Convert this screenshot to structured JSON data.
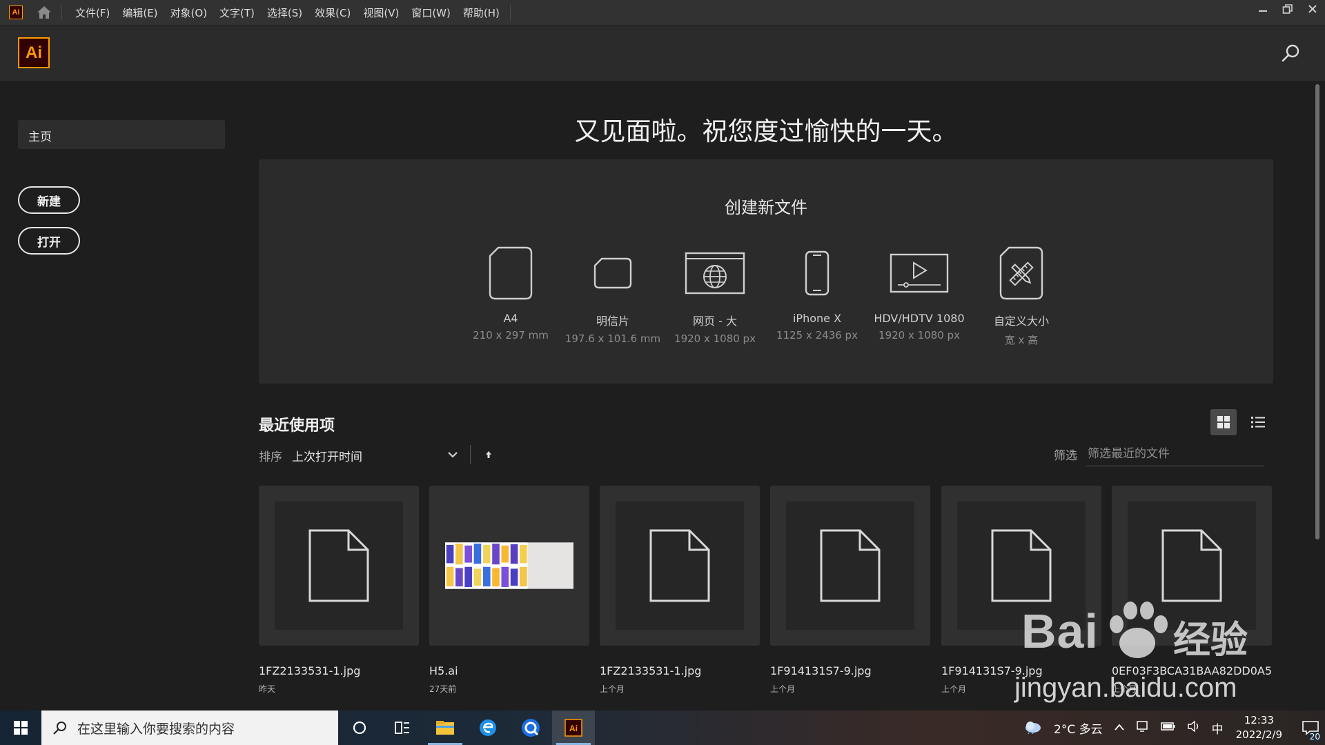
{
  "menubar": {
    "app_icon_text": "Ai",
    "items": [
      "文件(F)",
      "编辑(E)",
      "对象(O)",
      "文字(T)",
      "选择(S)",
      "效果(C)",
      "视图(V)",
      "窗口(W)",
      "帮助(H)"
    ]
  },
  "header": {
    "logo_text": "Ai"
  },
  "sidebar": {
    "home_label": "主页",
    "new_label": "新建",
    "open_label": "打开"
  },
  "greeting": "又见面啦。祝您度过愉快的一天。",
  "create": {
    "title": "创建新文件",
    "presets": [
      {
        "name": "A4",
        "size": "210 x 297 mm",
        "icon": "page-icon"
      },
      {
        "name": "明信片",
        "size": "197.6 x 101.6 mm",
        "icon": "postcard-icon"
      },
      {
        "name": "网页 - 大",
        "size": "1920 x 1080 px",
        "icon": "web-icon"
      },
      {
        "name": "iPhone X",
        "size": "1125 x 2436 px",
        "icon": "phone-icon"
      },
      {
        "name": "HDV/HDTV 1080",
        "size": "1920 x 1080 px",
        "icon": "video-icon"
      },
      {
        "name": "自定义大小",
        "size": "宽 x 高",
        "icon": "custom-size-icon"
      }
    ]
  },
  "recent": {
    "title": "最近使用项",
    "sort_label": "排序",
    "sort_value": "上次打开时间",
    "filter_label": "筛选",
    "filter_placeholder": "筛选最近的文件",
    "files": [
      {
        "name": "1FZ2133531-1.jpg",
        "time": "昨天",
        "thumb": false
      },
      {
        "name": "H5.ai",
        "time": "27天前",
        "thumb": true
      },
      {
        "name": "1FZ2133531-1.jpg",
        "time": "上个月",
        "thumb": false
      },
      {
        "name": "1F914131S7-9.jpg",
        "time": "上个月",
        "thumb": false
      },
      {
        "name": "1F914131S7-9.jpg",
        "time": "上个月",
        "thumb": false
      },
      {
        "name": "0EF03F3BCA31BAA82DD0A5...",
        "time": "上个月",
        "thumb": false
      }
    ]
  },
  "watermark": {
    "brand": "Bai",
    "cn": "经验",
    "url": "jingyan.baidu.com"
  },
  "taskbar": {
    "search_placeholder": "在这里输入你要搜索的内容",
    "weather": "2°C 多云",
    "ime": "中",
    "time": "12:33",
    "date": "2022/2/9",
    "notification_count": "20"
  },
  "colors": {
    "accent": "#ff9a00",
    "logo_bg": "#330000",
    "panel": "#2b2b2b",
    "bg": "#1e1e1e"
  }
}
